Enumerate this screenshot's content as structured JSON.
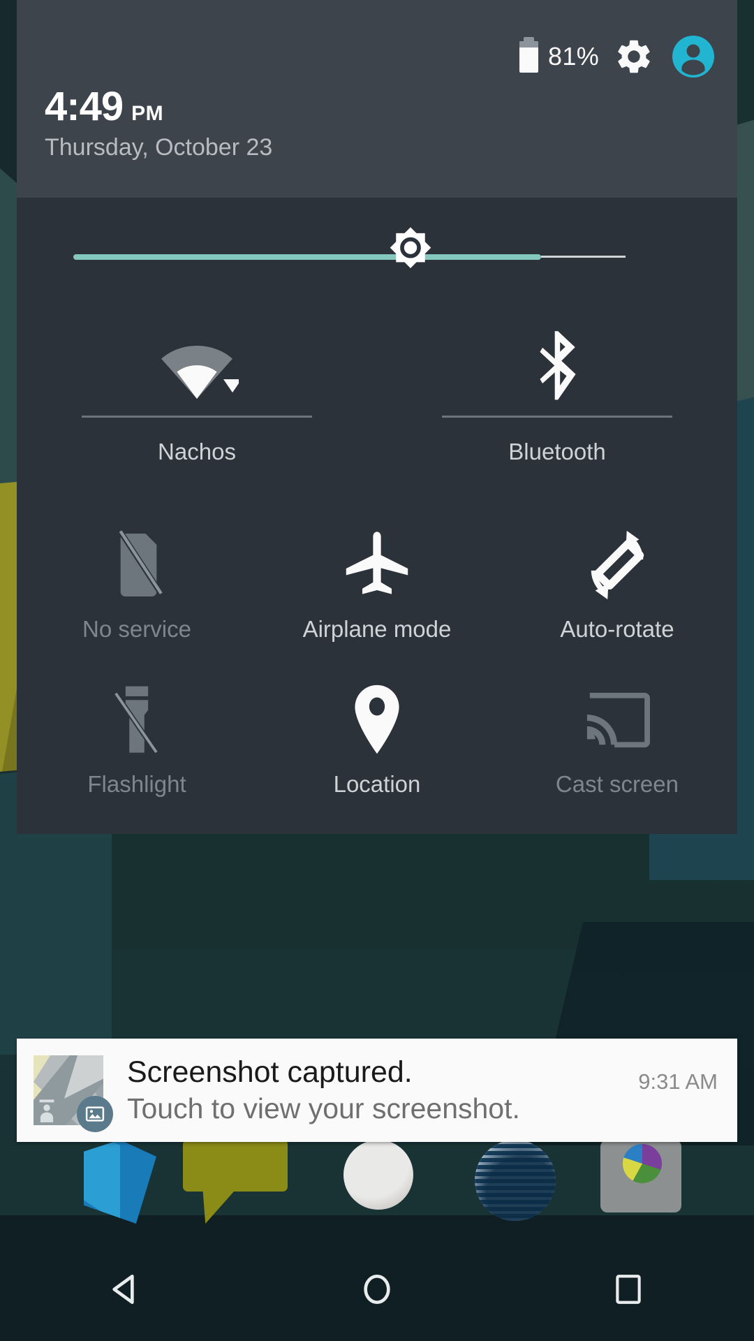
{
  "status_bar": {
    "battery_percent": "81%",
    "battery_level": 81,
    "battery_icon": "battery-icon",
    "settings_icon": "gear-icon",
    "user_icon": "user-avatar-icon",
    "accent_cyan": "#22b5d1"
  },
  "clock": {
    "time": "4:49",
    "ampm": "PM",
    "date": "Thursday, October 23"
  },
  "brightness": {
    "label": "brightness-slider",
    "value_percent": 85,
    "fill_color": "#85c7bd",
    "thumb_icon": "brightness-sun-icon"
  },
  "tiles_row_1": [
    {
      "label": "Nachos",
      "icon": "wifi-icon",
      "state": "on",
      "has_dropdown": true
    },
    {
      "label": "Bluetooth",
      "icon": "bluetooth-icon",
      "state": "on",
      "has_dropdown": false
    }
  ],
  "tiles_row_2": [
    {
      "label": "No service",
      "icon": "sim-off-icon",
      "state": "off"
    },
    {
      "label": "Airplane mode",
      "icon": "airplane-icon",
      "state": "on"
    },
    {
      "label": "Auto-rotate",
      "icon": "auto-rotate-icon",
      "state": "on"
    }
  ],
  "tiles_row_3": [
    {
      "label": "Flashlight",
      "icon": "flashlight-off-icon",
      "state": "off"
    },
    {
      "label": "Location",
      "icon": "location-pin-icon",
      "state": "on"
    },
    {
      "label": "Cast screen",
      "icon": "cast-screen-icon",
      "state": "off"
    }
  ],
  "notification": {
    "title": "Screenshot captured.",
    "subtitle": "Touch to view your screenshot.",
    "time": "9:31 AM",
    "thumbnail_icon": "screenshot-thumbnail",
    "badge_icon": "photo-icon"
  },
  "nav_bar": [
    {
      "icon": "back-icon",
      "label": "Back"
    },
    {
      "icon": "home-icon",
      "label": "Home"
    },
    {
      "icon": "recents-icon",
      "label": "Recents"
    }
  ],
  "colors": {
    "header_bg": "#3d444c",
    "panel_bg": "#2b3239",
    "tile_label": "#ced3d7",
    "tile_label_off": "#7f878e",
    "notification_bg": "#fafafa"
  }
}
